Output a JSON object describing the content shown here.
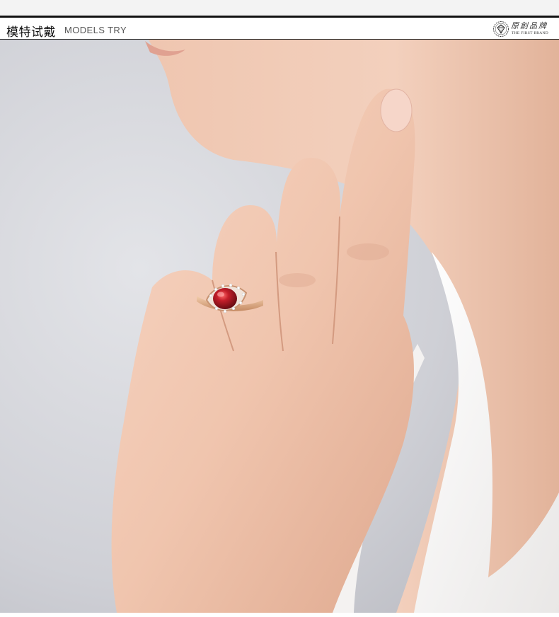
{
  "header": {
    "title_cn": "模特试戴",
    "title_en": "MODELS TRY"
  },
  "brand": {
    "name_cn": "原創品牌",
    "name_en": "THE FIRST BRAND",
    "logo_icon": "diamond-wreath-icon"
  },
  "photo": {
    "subject": "model-hand-wearing-ring",
    "gem_color": "#b01a24",
    "metal_color": "#d9a27c",
    "skin_color": "#f1c9b3",
    "background_color": "#cfd0d6"
  }
}
